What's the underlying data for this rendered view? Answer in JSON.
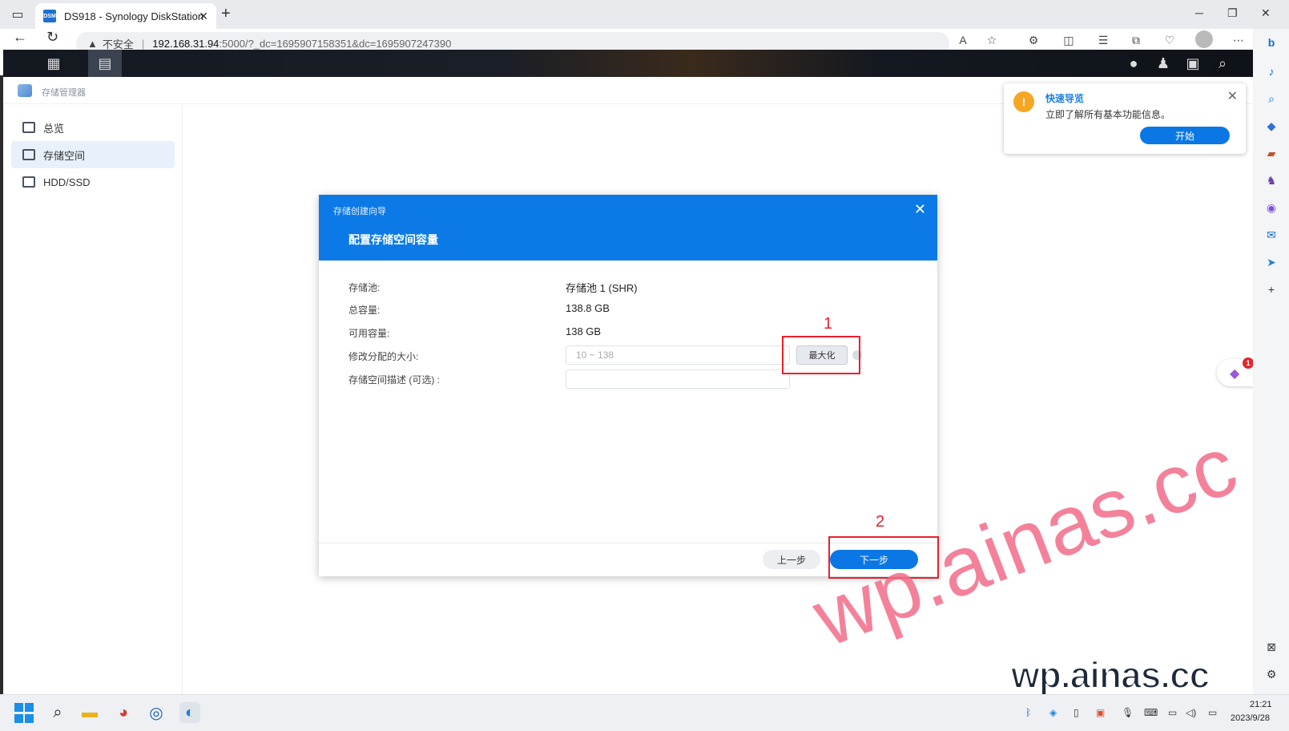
{
  "browser": {
    "tab_title": "DS918 - Synology DiskStation",
    "favicon_text": "DSM",
    "insecure_label": "不安全",
    "url_host": "192.168.31.94",
    "url_path": ":5000/?_dc=1695907158351&dc=1695907247390"
  },
  "window": {
    "title": "存储管理器"
  },
  "sidebar": {
    "items": [
      {
        "label": "总览"
      },
      {
        "label": "存储空间"
      },
      {
        "label": "HDD/SSD"
      }
    ]
  },
  "quick_nav": {
    "title": "快速导览",
    "text": "立即了解所有基本功能信息。",
    "button": "开始"
  },
  "float_badge": "1",
  "wizard": {
    "small_title": "存储创建向导",
    "title": "配置存储空间容量",
    "fields": [
      {
        "label": "存储池:",
        "value": "存储池 1 (SHR)"
      },
      {
        "label": "总容量:",
        "value": "138.8 GB"
      },
      {
        "label": "可用容量:",
        "value": "138 GB"
      },
      {
        "label": "修改分配的大小:",
        "placeholder": "10 ~ 138"
      },
      {
        "label": "存储空间描述 (可选) :"
      }
    ],
    "max_button": "最大化",
    "prev_button": "上一步",
    "next_button": "下一步"
  },
  "annotations": {
    "n1": "1",
    "n2": "2",
    "color": "#e8202c"
  },
  "watermark": {
    "diagonal": "wp.ainas.cc",
    "bold": "wp.ainas.cc"
  },
  "clock": {
    "time": "21:21",
    "date": "2023/9/28"
  },
  "colors": {
    "accent": "#0b77e4",
    "wizard_header": "#0b7ae6",
    "warning": "#f5a623"
  }
}
